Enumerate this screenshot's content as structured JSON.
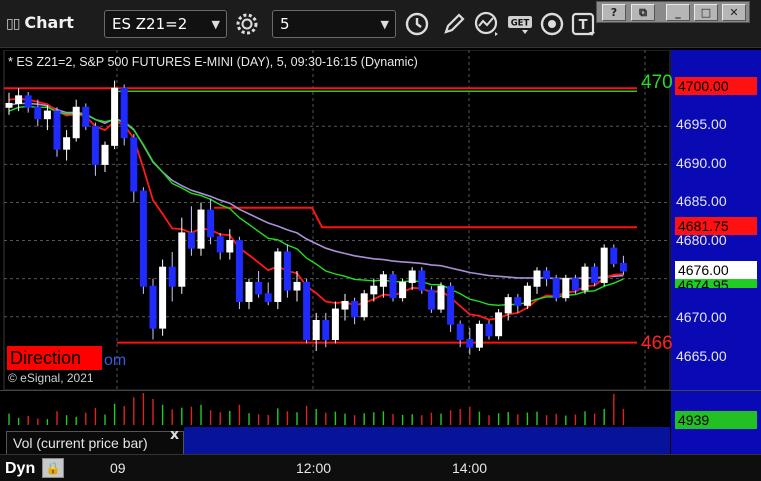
{
  "app": {
    "title": "Chart"
  },
  "toolbar": {
    "symbol": "ES Z21=2",
    "interval": "5",
    "icons": [
      "settings-gear-icon",
      "clock-icon",
      "draw-pencil-icon",
      "study-icon",
      "get-data-icon",
      "record-icon",
      "text-tool-icon"
    ],
    "get_label": "GET",
    "text_tool_label": "T"
  },
  "window_controls": [
    "help-icon",
    "restore-icon",
    "minimize-icon",
    "maximize-icon",
    "close-icon"
  ],
  "chart": {
    "title": "* ES Z21=2, S&P 500 FUTURES E-MINI (DAY), 5, 09:30-16:15 (Dynamic)",
    "copyright": "© eSignal, 2021",
    "direction_label": "Direction",
    "direction_tail": "om",
    "price_ticks": [
      "4700.00",
      "4695.00",
      "4690.00",
      "4685.00",
      "4680.00",
      "4675.00",
      "4670.00",
      "4665.00"
    ],
    "tags": {
      "upper_level": "4700.00",
      "mid_level": "4681.75",
      "last_price": "4676.00",
      "ma_value": "4674.95",
      "upper_edge_text": "470",
      "lower_edge_text": "466"
    },
    "colors": {
      "up_candle": "#ffffff",
      "down_candle": "#1f2bff",
      "fast_ma": "#ff1a1a",
      "slow_ma": "#22dd22",
      "vwap": "#a98fd6",
      "level_red": "#ff1111",
      "level_green": "#22cc22"
    }
  },
  "chart_data": {
    "type": "candlestick",
    "symbol": "ES Z21=2",
    "interval_minutes": 5,
    "session": "09:30-16:15",
    "x_ticks": [
      "09",
      "12:00",
      "14:00"
    ],
    "ylim": [
      4663,
      4702
    ],
    "levels": [
      4700.0,
      4681.75,
      4666.6
    ],
    "candles": [
      [
        4697.5,
        4699.4,
        4696.5,
        4698.0
      ],
      [
        4698.0,
        4700.0,
        4697.0,
        4699.0
      ],
      [
        4699.0,
        4699.5,
        4696.8,
        4697.5
      ],
      [
        4697.5,
        4698.5,
        4695.0,
        4696.0
      ],
      [
        4696.0,
        4697.8,
        4694.5,
        4697.0
      ],
      [
        4697.0,
        4697.5,
        4691.0,
        4692.0
      ],
      [
        4692.0,
        4694.5,
        4690.5,
        4693.5
      ],
      [
        4693.5,
        4698.5,
        4693.0,
        4697.5
      ],
      [
        4697.5,
        4698.0,
        4694.5,
        4695.0
      ],
      [
        4695.0,
        4695.5,
        4688.5,
        4690.0
      ],
      [
        4690.0,
        4693.0,
        4689.0,
        4692.5
      ],
      [
        4692.5,
        4701.0,
        4692.0,
        4700.0
      ],
      [
        4700.0,
        4700.5,
        4692.5,
        4693.5
      ],
      [
        4693.5,
        4694.0,
        4685.0,
        4686.5
      ],
      [
        4686.5,
        4687.0,
        4673.0,
        4674.0
      ],
      [
        4674.0,
        4675.0,
        4667.0,
        4668.5
      ],
      [
        4668.5,
        4677.5,
        4667.5,
        4676.5
      ],
      [
        4676.5,
        4678.5,
        4672.0,
        4674.0
      ],
      [
        4674.0,
        4683.0,
        4673.0,
        4681.0
      ],
      [
        4681.0,
        4684.5,
        4678.0,
        4679.0
      ],
      [
        4679.0,
        4685.0,
        4678.0,
        4684.0
      ],
      [
        4684.0,
        4685.5,
        4679.5,
        4680.5
      ],
      [
        4680.5,
        4681.0,
        4677.5,
        4678.5
      ],
      [
        4678.5,
        4681.5,
        4677.5,
        4680.0
      ],
      [
        4680.0,
        4680.5,
        4671.0,
        4672.0
      ],
      [
        4672.0,
        4675.0,
        4671.0,
        4674.5
      ],
      [
        4674.5,
        4676.0,
        4672.5,
        4673.0
      ],
      [
        4673.0,
        4674.5,
        4671.5,
        4672.0
      ],
      [
        4672.0,
        4679.0,
        4671.0,
        4678.5
      ],
      [
        4678.5,
        4679.5,
        4672.5,
        4673.5
      ],
      [
        4673.5,
        4676.0,
        4672.0,
        4674.5
      ],
      [
        4674.5,
        4675.0,
        4666.5,
        4667.0
      ],
      [
        4667.0,
        4670.5,
        4665.5,
        4669.5
      ],
      [
        4669.5,
        4670.5,
        4666.0,
        4667.0
      ],
      [
        4667.0,
        4672.0,
        4666.5,
        4671.0
      ],
      [
        4671.0,
        4673.0,
        4669.5,
        4672.0
      ],
      [
        4672.0,
        4672.5,
        4669.0,
        4670.0
      ],
      [
        4670.0,
        4673.5,
        4669.5,
        4673.0
      ],
      [
        4673.0,
        4675.0,
        4672.0,
        4674.0
      ],
      [
        4674.0,
        4676.0,
        4672.5,
        4675.5
      ],
      [
        4675.5,
        4676.0,
        4672.0,
        4672.5
      ],
      [
        4672.5,
        4675.0,
        4672.0,
        4674.5
      ],
      [
        4674.5,
        4676.5,
        4673.5,
        4676.0
      ],
      [
        4676.0,
        4676.5,
        4673.0,
        4673.5
      ],
      [
        4673.5,
        4674.0,
        4670.5,
        4671.0
      ],
      [
        4671.0,
        4674.5,
        4670.5,
        4674.0
      ],
      [
        4674.0,
        4674.5,
        4668.0,
        4669.0
      ],
      [
        4669.0,
        4669.5,
        4666.0,
        4667.0
      ],
      [
        4667.0,
        4668.5,
        4665.0,
        4666.0
      ],
      [
        4666.0,
        4669.5,
        4665.5,
        4669.0
      ],
      [
        4669.0,
        4669.5,
        4667.0,
        4667.5
      ],
      [
        4667.5,
        4671.0,
        4667.0,
        4670.5
      ],
      [
        4670.5,
        4673.0,
        4669.5,
        4672.5
      ],
      [
        4672.5,
        4673.0,
        4670.5,
        4671.5
      ],
      [
        4671.5,
        4674.5,
        4671.0,
        4674.0
      ],
      [
        4674.0,
        4676.5,
        4673.0,
        4676.0
      ],
      [
        4676.0,
        4676.5,
        4674.0,
        4675.0
      ],
      [
        4675.0,
        4675.5,
        4672.0,
        4672.5
      ],
      [
        4672.5,
        4675.5,
        4672.0,
        4675.0
      ],
      [
        4675.0,
        4675.5,
        4673.0,
        4673.5
      ],
      [
        4673.5,
        4677.0,
        4673.0,
        4676.5
      ],
      [
        4676.5,
        4677.0,
        4674.0,
        4674.5
      ],
      [
        4674.5,
        4679.5,
        4674.0,
        4679.0
      ],
      [
        4679.0,
        4679.5,
        4676.5,
        4677.0
      ],
      [
        4677.0,
        4678.0,
        4675.5,
        4676.0
      ]
    ],
    "fast_ma": [
      4698.5,
      4698.6,
      4698.5,
      4698.2,
      4697.9,
      4697.0,
      4696.4,
      4696.6,
      4696.3,
      4695.0,
      4694.5,
      4695.6,
      4695.2,
      4693.4,
      4689.5,
      4685.3,
      4683.5,
      4681.6,
      4681.5,
      4681.0,
      4681.6,
      4681.4,
      4680.8,
      4680.7,
      4679.0,
      4678.1,
      4677.1,
      4676.1,
      4676.6,
      4676.0,
      4675.7,
      4674.0,
      4673.1,
      4672.0,
      4671.8,
      4671.9,
      4671.5,
      4671.8,
      4672.3,
      4672.9,
      4672.8,
      4673.2,
      4673.8,
      4673.7,
      4673.2,
      4673.4,
      4672.5,
      4671.4,
      4670.3,
      4670.1,
      4669.6,
      4669.8,
      4670.3,
      4670.5,
      4671.2,
      4672.2,
      4672.8,
      4672.7,
      4673.2,
      4673.3,
      4674.0,
      4674.1,
      4675.1,
      4675.5,
      4675.6
    ],
    "slow_ma": [
      4697.0,
      4697.5,
      4697.6,
      4697.5,
      4697.5,
      4696.9,
      4696.6,
      4696.7,
      4696.5,
      4695.9,
      4695.6,
      4695.9,
      4695.5,
      4694.5,
      4692.6,
      4690.4,
      4689.0,
      4687.5,
      4686.9,
      4686.2,
      4685.9,
      4685.4,
      4684.7,
      4684.2,
      4683.0,
      4682.1,
      4681.2,
      4680.3,
      4680.1,
      4679.4,
      4678.9,
      4677.7,
      4676.9,
      4676.0,
      4675.6,
      4675.3,
      4674.9,
      4674.8,
      4674.7,
      4674.8,
      4674.6,
      4674.6,
      4674.7,
      4674.6,
      4674.2,
      4674.2,
      4673.6,
      4673.0,
      4672.3,
      4672.0,
      4671.6,
      4671.5,
      4671.6,
      4671.6,
      4671.9,
      4672.3,
      4672.6,
      4672.6,
      4672.8,
      4672.9,
      4673.3,
      4673.4,
      4674.0,
      4674.4,
      4674.95
    ],
    "vwap": [
      4697.8,
      4698.0,
      4698.0,
      4697.9,
      4697.7,
      4697.2,
      4696.8,
      4696.8,
      4696.6,
      4695.9,
      4695.4,
      4696.0,
      4695.6,
      4694.6,
      4692.5,
      4690.3,
      4689.0,
      4687.9,
      4687.2,
      4686.6,
      4686.2,
      4685.8,
      4685.3,
      4684.9,
      4684.1,
      4683.5,
      4682.9,
      4682.3,
      4681.9,
      4681.4,
      4681.0,
      4680.2,
      4679.6,
      4679.0,
      4678.6,
      4678.3,
      4678.0,
      4677.8,
      4677.6,
      4677.5,
      4677.3,
      4677.2,
      4677.1,
      4677.0,
      4676.8,
      4676.7,
      4676.4,
      4676.1,
      4675.8,
      4675.6,
      4675.4,
      4675.3,
      4675.2,
      4675.1,
      4675.1,
      4675.1,
      4675.1,
      4675.0,
      4675.0,
      4675.0,
      4675.1,
      4675.1,
      4675.2,
      4675.3,
      4675.4
    ],
    "volume": [
      3500,
      2200,
      2800,
      2000,
      1800,
      4200,
      3000,
      2500,
      3800,
      5200,
      3200,
      6500,
      5800,
      8500,
      9800,
      8000,
      6200,
      4800,
      5300,
      5600,
      6200,
      4500,
      3900,
      4300,
      6200,
      3600,
      3300,
      3100,
      5100,
      4200,
      3900,
      5900,
      4900,
      3800,
      4100,
      3500,
      3000,
      3600,
      3900,
      4200,
      3400,
      3100,
      3300,
      3000,
      3800,
      3500,
      4500,
      4900,
      5600,
      4100,
      3000,
      3600,
      4000,
      3300,
      3800,
      4100,
      3000,
      3400,
      2900,
      3200,
      4200,
      3500,
      4939,
      9500,
      4939
    ],
    "last_volume": "4939",
    "volume_pane_label": "Vol (current price bar)"
  },
  "time_axis": {
    "mode_label": "Dyn",
    "mode_icon": "lock-icon"
  }
}
